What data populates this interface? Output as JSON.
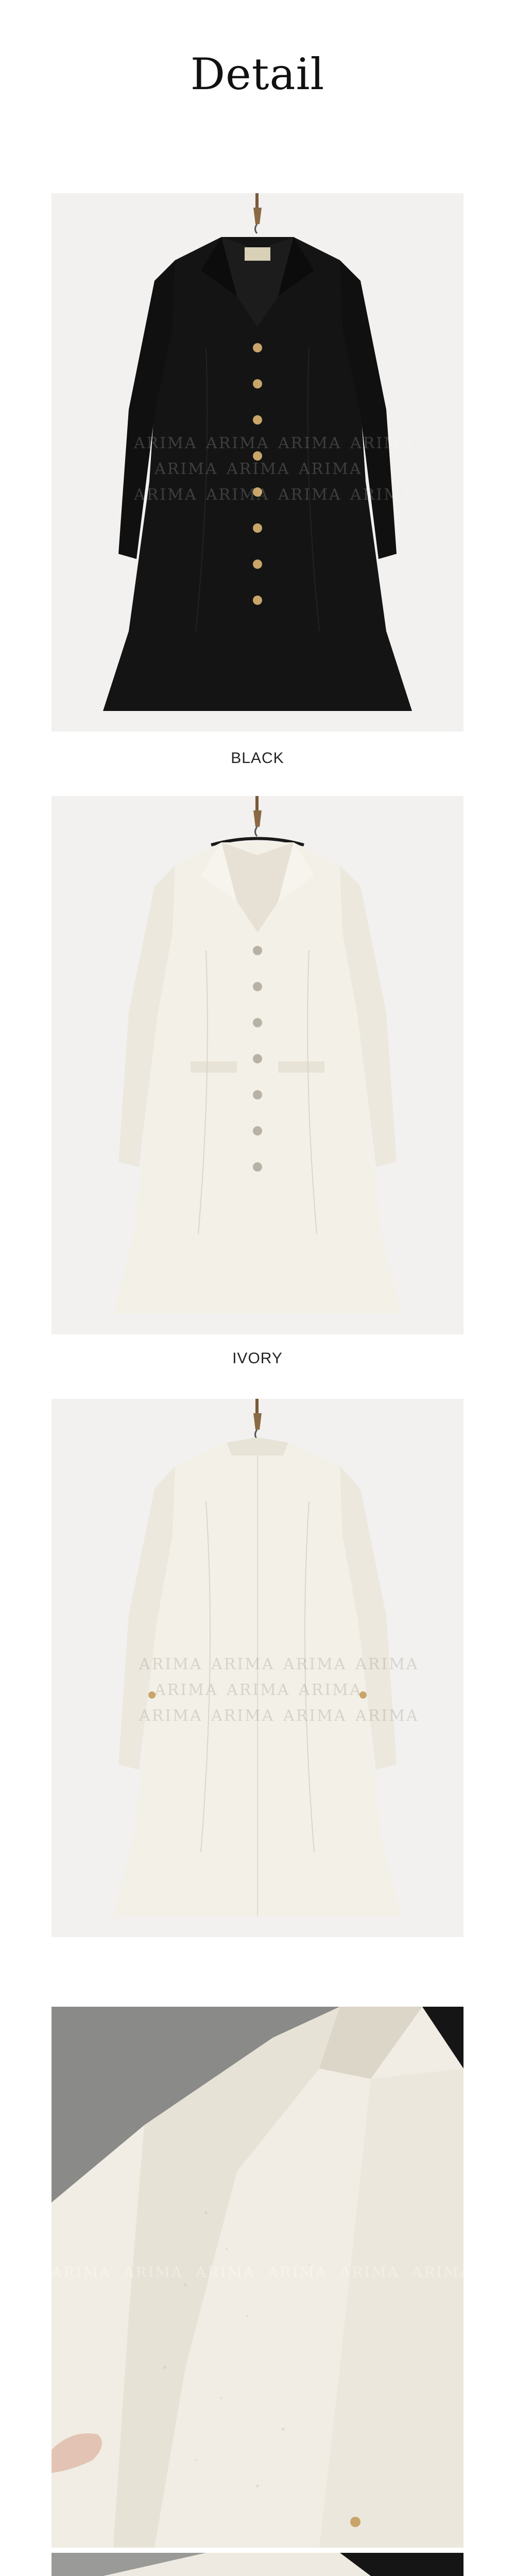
{
  "header": {
    "title": "Detail"
  },
  "products": [
    {
      "color_label": "BLACK",
      "view": "front",
      "watermark": "ARIMA"
    },
    {
      "color_label": "IVORY",
      "view": "front",
      "watermark": ""
    },
    {
      "color_label": "",
      "view": "back",
      "watermark": "ARIMA"
    }
  ],
  "closeup": {
    "watermark": "ARIMA"
  },
  "colors": {
    "black_coat": "#141414",
    "ivory_coat": "#f3f0e8",
    "backdrop": "#f2f1ef",
    "button_gold": "#c9a56a",
    "caption_text": "#222222"
  }
}
